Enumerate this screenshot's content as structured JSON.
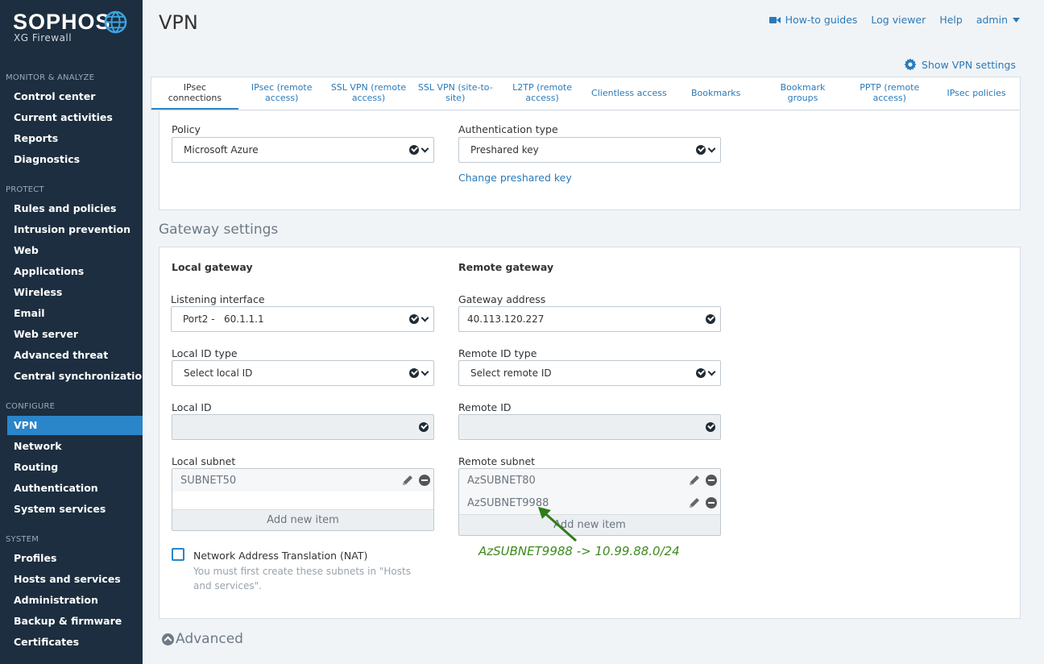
{
  "brand": {
    "name": "SOPHOS",
    "product": "XG Firewall"
  },
  "sidebar": {
    "sections": [
      {
        "title": "MONITOR & ANALYZE",
        "items": [
          "Control center",
          "Current activities",
          "Reports",
          "Diagnostics"
        ]
      },
      {
        "title": "PROTECT",
        "items": [
          "Rules and policies",
          "Intrusion prevention",
          "Web",
          "Applications",
          "Wireless",
          "Email",
          "Web server",
          "Advanced threat",
          "Central synchronization"
        ]
      },
      {
        "title": "CONFIGURE",
        "items": [
          "VPN",
          "Network",
          "Routing",
          "Authentication",
          "System services"
        ]
      },
      {
        "title": "SYSTEM",
        "items": [
          "Profiles",
          "Hosts and services",
          "Administration",
          "Backup & firmware",
          "Certificates"
        ]
      }
    ],
    "active": "VPN"
  },
  "header": {
    "title": "VPN",
    "links": {
      "howto": "How-to guides",
      "logviewer": "Log viewer",
      "help": "Help",
      "user": "admin"
    },
    "show_vpn_settings": "Show VPN settings"
  },
  "tabs": [
    "IPsec connections",
    "IPsec (remote access)",
    "SSL VPN (remote access)",
    "SSL VPN (site-to-site)",
    "L2TP (remote access)",
    "Clientless access",
    "Bookmarks",
    "Bookmark groups",
    "PPTP (remote access)",
    "IPsec policies"
  ],
  "general": {
    "policy_label": "Policy",
    "policy_value": "Microsoft Azure",
    "auth_label": "Authentication type",
    "auth_value": "Preshared key",
    "change_psk": "Change preshared key"
  },
  "gateway": {
    "section_title": "Gateway settings",
    "local_title": "Local gateway",
    "remote_title": "Remote gateway",
    "listening_label": "Listening interface",
    "listening_value": "Port2 -   60.1.1.1",
    "gateway_addr_label": "Gateway address",
    "gateway_addr_value": "40.113.120.227",
    "local_id_type_label": "Local ID type",
    "local_id_type_value": "Select local ID",
    "remote_id_type_label": "Remote ID type",
    "remote_id_type_value": "Select remote ID",
    "local_id_label": "Local ID",
    "remote_id_label": "Remote ID",
    "local_subnet_label": "Local subnet",
    "local_subnets": [
      "SUBNET50"
    ],
    "remote_subnet_label": "Remote subnet",
    "remote_subnets": [
      "AzSUBNET80",
      "AzSUBNET9988"
    ],
    "add_new_item": "Add new item",
    "nat_label": "Network Address Translation (NAT)",
    "nat_hint_line1": "You must first create these subnets in \"Hosts",
    "nat_hint_line2": "and services\"."
  },
  "annotation": "AzSUBNET9988 -> 10.99.88.0/24",
  "advanced_label": "Advanced"
}
